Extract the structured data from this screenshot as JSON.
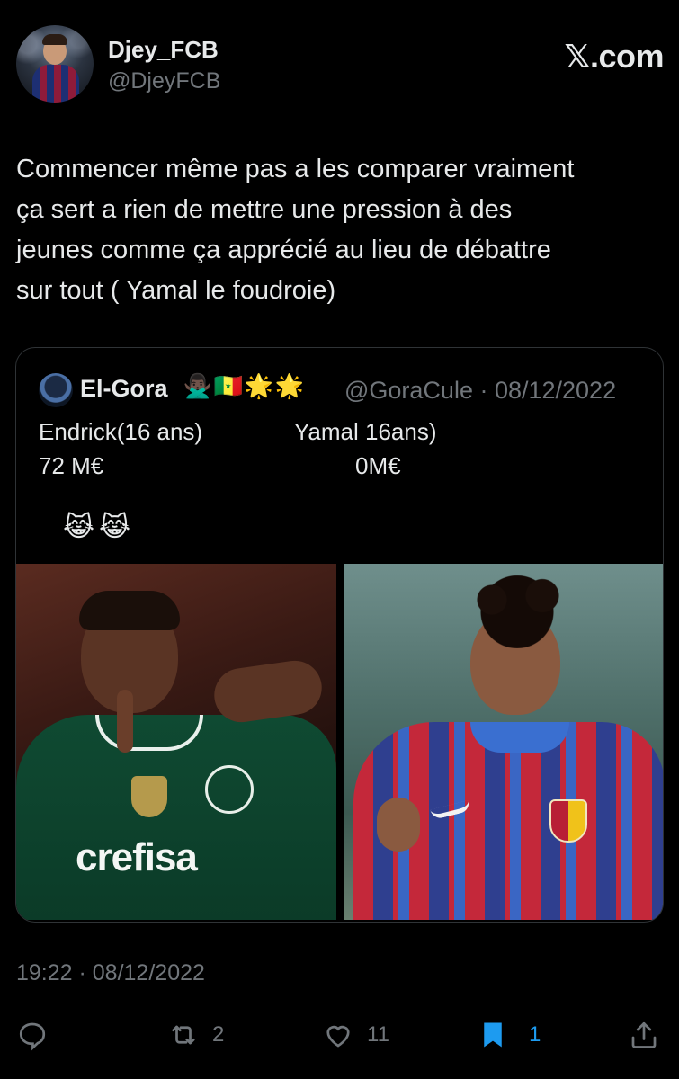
{
  "author": {
    "display_name": "Djey_FCB",
    "handle": "@DjeyFCB"
  },
  "brand": {
    "x_mark": "𝕏",
    "domain": ".com"
  },
  "tweet": {
    "lines": [
      "Commencer même pas a les comparer vraiment",
      "ça sert a rien de mettre une pression à des",
      "jeunes comme ça apprécié au lieu de débattre",
      "sur tout ( Yamal le foudroie)"
    ]
  },
  "quote": {
    "display_name": "El-Gora",
    "emojis": [
      "🙅🏿‍♂️",
      "🇸🇳",
      "🌟",
      "🌟"
    ],
    "handle_date": "@GoraCule · 08/12/2022",
    "row1_left": "Endrick(16 ans)",
    "row1_right": "Yamal 16ans)",
    "row2_left": "72 M€",
    "row2_right": "0M€",
    "laugh_emojis": [
      "😹",
      "😹"
    ]
  },
  "meta": {
    "timestamp": "19:22 · 08/12/2022"
  },
  "actions": {
    "retweets": "2",
    "likes": "11",
    "bookmarks": "1"
  },
  "colors": {
    "background": "#000000",
    "text": "#e7e9ea",
    "muted": "#71767b",
    "accent": "#1d9bf0",
    "border": "#2f3336"
  },
  "icons": [
    "reply-icon",
    "retweet-icon",
    "heart-icon",
    "bookmark-icon",
    "share-icon"
  ]
}
